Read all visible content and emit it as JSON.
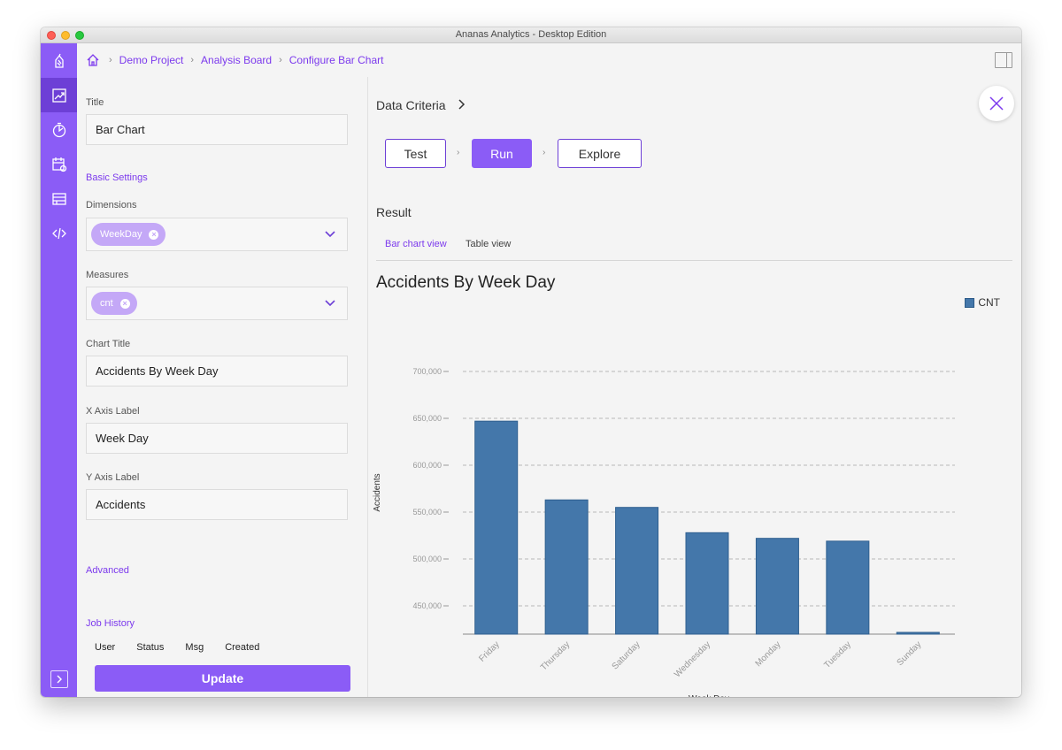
{
  "window": {
    "title": "Ananas Analytics - Desktop Edition"
  },
  "rail": {
    "items": [
      {
        "name": "logo-icon"
      },
      {
        "name": "analysis-board-icon",
        "active": true
      },
      {
        "name": "dashboard-icon"
      },
      {
        "name": "scheduler-icon"
      },
      {
        "name": "data-table-icon"
      },
      {
        "name": "code-icon"
      }
    ],
    "expand_icon": "chevron-right-icon"
  },
  "breadcrumb": {
    "home_icon": "home-icon",
    "items": [
      "Demo Project",
      "Analysis Board",
      "Configure Bar Chart"
    ],
    "separator": "›"
  },
  "form": {
    "title_label": "Title",
    "title_value": "Bar Chart",
    "basic_settings": "Basic Settings",
    "dimensions_label": "Dimensions",
    "dimensions_chip": "WeekDay",
    "measures_label": "Measures",
    "measures_chip": "cnt",
    "chart_title_label": "Chart Title",
    "chart_title_value": "Accidents By Week Day",
    "x_axis_label": "X Axis Label",
    "x_axis_value": "Week Day",
    "y_axis_label": "Y Axis Label",
    "y_axis_value": "Accidents",
    "advanced": "Advanced",
    "job_history": "Job History",
    "job_columns": [
      "User",
      "Status",
      "Msg",
      "Created"
    ],
    "update_label": "Update"
  },
  "right": {
    "data_criteria": "Data Criteria",
    "steps": [
      "Test",
      "Run",
      "Explore"
    ],
    "step_sep": "›",
    "result_label": "Result",
    "tabs": [
      "Bar chart view",
      "Table view"
    ],
    "chart_title": "Accidents By Week Day",
    "legend": "CNT"
  },
  "colors": {
    "accent": "#8b5cf6",
    "accent_dark": "#6d3fd6",
    "bar": "#4477aa"
  },
  "chart_data": {
    "type": "bar",
    "title": "Accidents By Week Day",
    "xlabel": "Week Day",
    "ylabel": "Accidents",
    "categories": [
      "Friday",
      "Thursday",
      "Saturday",
      "Wednesday",
      "Monday",
      "Tuesday",
      "Sunday"
    ],
    "series": [
      {
        "name": "CNT",
        "values": [
          647000,
          563000,
          555000,
          528000,
          522000,
          519000,
          420000
        ]
      }
    ],
    "ylim": [
      420000,
      700000
    ],
    "yticks": [
      450000,
      500000,
      550000,
      600000,
      650000,
      700000
    ],
    "ytick_labels": [
      "450,000",
      "500,000",
      "550,000",
      "600,000",
      "650,000",
      "700,000"
    ],
    "grid": true,
    "legend_position": "top-right"
  }
}
